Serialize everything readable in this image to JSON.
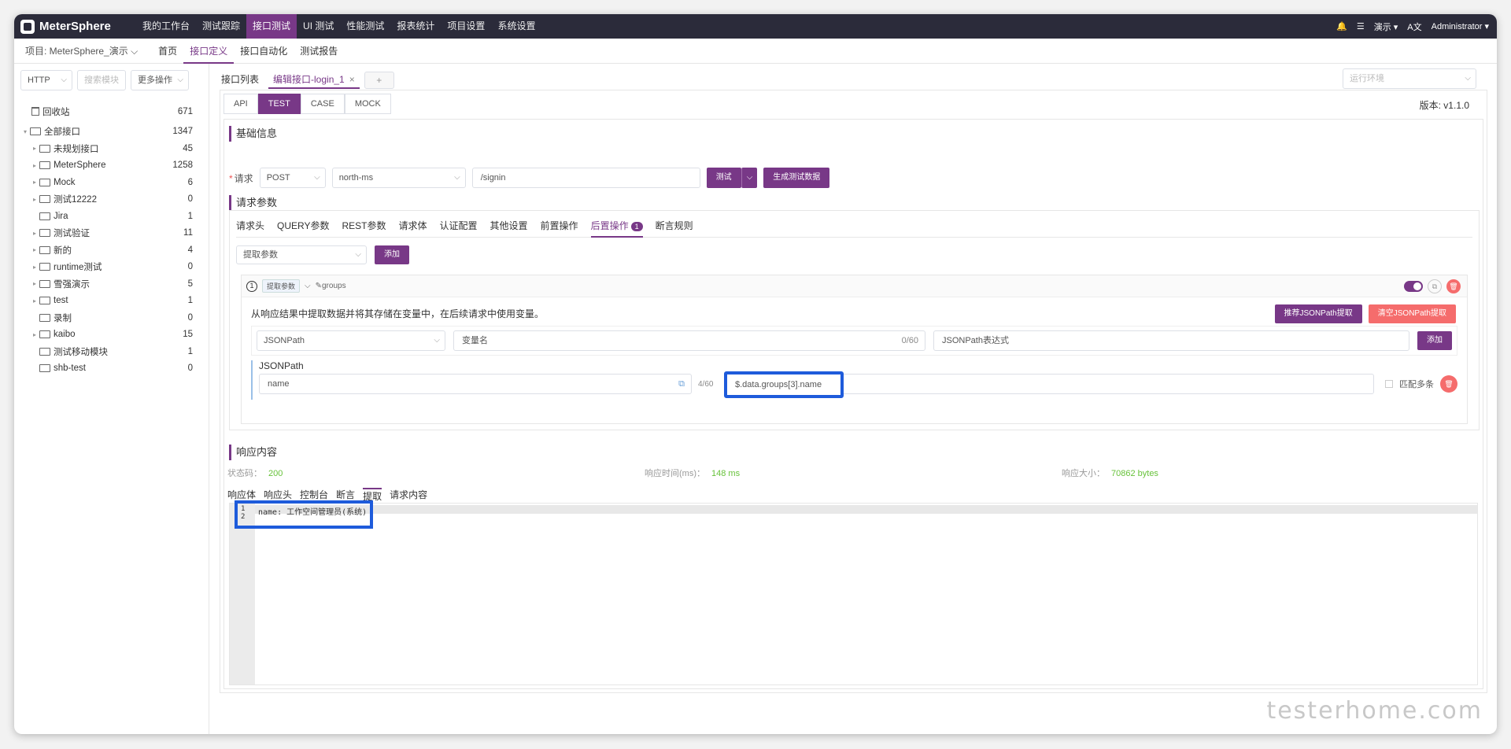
{
  "app": {
    "name": "MeterSphere"
  },
  "topnav": {
    "items": [
      "我的工作台",
      "测试跟踪",
      "接口测试",
      "UI 测试",
      "性能测试",
      "报表统计",
      "项目设置",
      "系统设置"
    ],
    "active_index": 2,
    "right": {
      "workspace": "演示",
      "lang": "A文",
      "user": "Administrator"
    }
  },
  "projectbar": {
    "project": "项目: MeterSphere_演示",
    "tabs": [
      "首页",
      "接口定义",
      "接口自动化",
      "测试报告"
    ],
    "active_index": 1
  },
  "sidebar": {
    "protocol": "HTTP",
    "search_placeholder": "搜索模块",
    "more_label": "更多操作",
    "trash": {
      "label": "回收站",
      "count": "671"
    },
    "root": {
      "label": "全部接口",
      "count": "1347"
    },
    "items": [
      {
        "label": "未规划接口",
        "count": "45",
        "expandable": true
      },
      {
        "label": "MeterSphere",
        "count": "1258",
        "expandable": true
      },
      {
        "label": "Mock",
        "count": "6",
        "expandable": true
      },
      {
        "label": "测试12222",
        "count": "0",
        "expandable": true
      },
      {
        "label": "Jira",
        "count": "1",
        "expandable": false
      },
      {
        "label": "测试验证",
        "count": "11",
        "expandable": true
      },
      {
        "label": "新的",
        "count": "4",
        "expandable": true
      },
      {
        "label": "runtime测试",
        "count": "0",
        "expandable": true
      },
      {
        "label": "雪强演示",
        "count": "5",
        "expandable": true
      },
      {
        "label": "test",
        "count": "1",
        "expandable": true
      },
      {
        "label": "录制",
        "count": "0",
        "expandable": false
      },
      {
        "label": "kaibo",
        "count": "15",
        "expandable": true
      },
      {
        "label": "测试移动模块",
        "count": "1",
        "expandable": false
      },
      {
        "label": "shb-test",
        "count": "0",
        "expandable": false
      }
    ]
  },
  "doctabs": {
    "list": "接口列表",
    "edit": "编辑接口-login_1",
    "close": "×",
    "add": "+"
  },
  "env_placeholder": "运行环境",
  "modes": [
    "API",
    "TEST",
    "CASE",
    "MOCK"
  ],
  "active_mode": 1,
  "version": "版本: v1.1.0",
  "basic": {
    "title": "基础信息",
    "req_label": "请求",
    "method": "POST",
    "service": "north-ms",
    "path": "/signin",
    "test_btn": "测试",
    "gen_btn": "生成测试数据"
  },
  "params": {
    "title": "请求参数",
    "tabs": [
      "请求头",
      "QUERY参数",
      "REST参数",
      "请求体",
      "认证配置",
      "其他设置",
      "前置操作",
      "后置操作",
      "断言规则"
    ],
    "active_index": 7,
    "badge": "1",
    "select": "提取参数",
    "add_btn": "添加"
  },
  "extract": {
    "index": "1",
    "tag": "提取参数",
    "name": "groups",
    "desc": "从响应结果中提取数据并将其存储在变量中，在后续请求中使用变量。",
    "recommend_btn": "推荐JSONPath提取",
    "clear_btn": "清空JSONPath提取",
    "type": "JSONPath",
    "var_placeholder": "变量名",
    "var_counter": "0/60",
    "expr_placeholder": "JSONPath表达式",
    "add_btn": "添加",
    "section_label": "JSONPath",
    "var_value": "name",
    "value_counter": "4/60",
    "expr_value": "$.data.groups[3].name",
    "match_label": "匹配多条"
  },
  "response": {
    "title": "响应内容",
    "status_label": "状态码：",
    "status": "200",
    "time_label": "响应时间(ms)：",
    "time": "148 ms",
    "size_label": "响应大小：",
    "size": "70862 bytes",
    "tabs": [
      "响应体",
      "响应头",
      "控制台",
      "断言",
      "提取",
      "请求内容"
    ],
    "lines": [
      "1",
      "2"
    ],
    "code": "name: 工作空间管理员(系统)"
  },
  "watermark": "testerhome.com"
}
